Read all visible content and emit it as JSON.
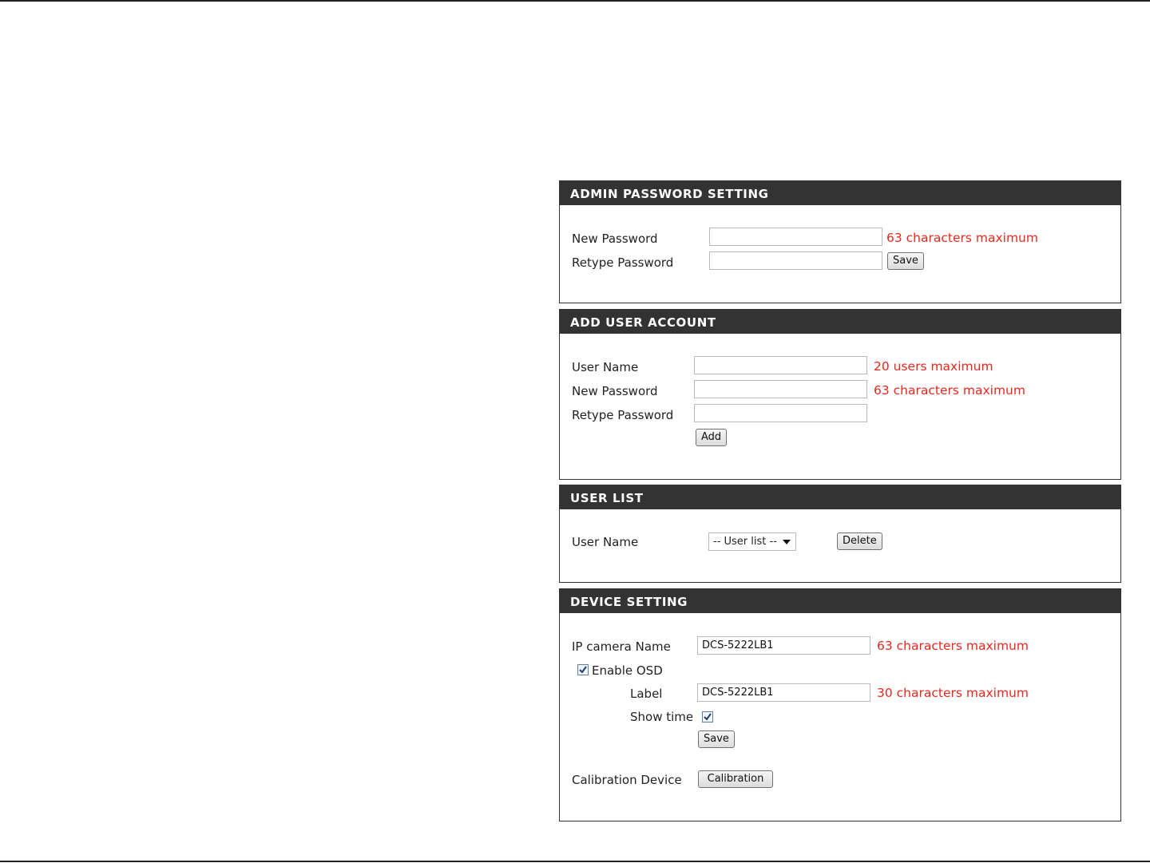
{
  "admin_password": {
    "title": "ADMIN PASSWORD SETTING",
    "new_password_label": "New Password",
    "new_password_value": "",
    "new_password_hint": "63 characters maximum",
    "retype_password_label": "Retype Password",
    "retype_password_value": "",
    "save_label": "Save"
  },
  "add_user": {
    "title": "ADD USER ACCOUNT",
    "user_name_label": "User Name",
    "user_name_value": "",
    "user_name_hint": "20 users maximum",
    "new_password_label": "New Password",
    "new_password_value": "",
    "new_password_hint": "63 characters maximum",
    "retype_password_label": "Retype Password",
    "retype_password_value": "",
    "add_label": "Add"
  },
  "user_list": {
    "title": "USER LIST",
    "user_name_label": "User Name",
    "select_value": "-- User list --",
    "delete_label": "Delete"
  },
  "device_setting": {
    "title": "DEVICE SETTING",
    "camera_name_label": "IP camera Name",
    "camera_name_value": "DCS-5222LB1",
    "camera_name_hint": "63 characters maximum",
    "enable_osd_label": "Enable OSD",
    "enable_osd_checked": true,
    "osd_label_label": "Label",
    "osd_label_value": "DCS-5222LB1",
    "osd_label_hint": "30 characters maximum",
    "show_time_label": "Show time",
    "show_time_checked": true,
    "save_label": "Save",
    "calibration_label": "Calibration Device",
    "calibration_button": "Calibration"
  },
  "colors": {
    "header_bg": "#333333",
    "hint_red": "#e8281e"
  }
}
